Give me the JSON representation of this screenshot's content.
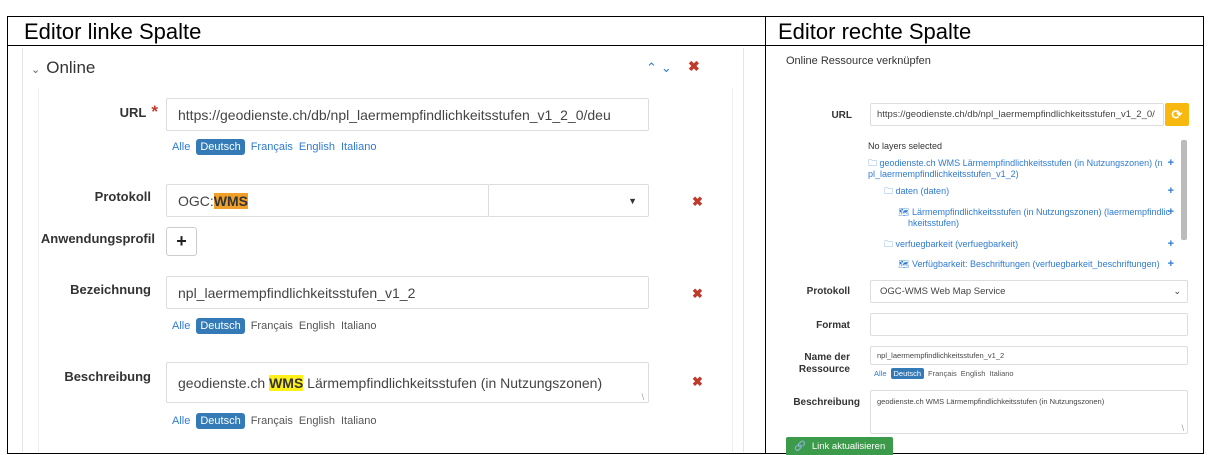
{
  "headers": {
    "left": "Editor linke Spalte",
    "right": "Editor rechte Spalte"
  },
  "left": {
    "section_title": "Online",
    "url": {
      "label": "URL",
      "required_mark": "*",
      "value": "https://geodienste.ch/db/npl_laermempfindlichkeitsstufen_v1_2_0/deu"
    },
    "languages": [
      "Alle",
      "Deutsch",
      "Français",
      "English",
      "Italiano"
    ],
    "protokoll": {
      "label": "Protokoll",
      "value_prefix": "OGC:",
      "value_highlight": "WMS"
    },
    "anwendungsprofil": {
      "label": "Anwendungsprofil",
      "add_label": "+"
    },
    "bezeichnung": {
      "label": "Bezeichnung",
      "value": "npl_laermempfindlichkeitsstufen_v1_2"
    },
    "beschreibung": {
      "label": "Beschreibung",
      "value_prefix": "geodienste.ch ",
      "value_highlight": "WMS",
      "value_suffix": " Lärmempfindlichkeitsstufen (in Nutzungszonen)"
    }
  },
  "right": {
    "title": "Online Ressource verknüpfen",
    "url": {
      "label": "URL",
      "value": "https://geodienste.ch/db/npl_laermempfindlichkeitsstufen_v1_2_0/"
    },
    "layers": {
      "none_selected": "No layers selected",
      "items": [
        {
          "text": "geodienste.ch WMS Lärmempfindlichkeitsstufen (in Nutzungszonen) (n",
          "text2": "pl_laermempfindlichkeitsstufen_v1_2)"
        },
        {
          "text": "daten (daten)"
        },
        {
          "text": "Lärmempfindlichkeitsstufen (in Nutzungszonen) (laermempfindlic",
          "text2": "hkeitsstufen)"
        },
        {
          "text": "verfuegbarkeit (verfuegbarkeit)"
        },
        {
          "text": "Verfügbarkeit: Beschriftungen (verfuegbarkeit_beschriftungen)"
        }
      ]
    },
    "protokoll": {
      "label": "Protokoll",
      "value": "OGC-WMS Web Map Service"
    },
    "format": {
      "label": "Format",
      "value": ""
    },
    "name": {
      "label_line1": "Name der",
      "label_line2": "Ressource",
      "value": "npl_laermempfindlichkeitsstufen_v1_2"
    },
    "languages": [
      "Alle",
      "Deutsch",
      "Français",
      "English",
      "Italiano"
    ],
    "beschreibung": {
      "label": "Beschreibung",
      "value": "geodienste.ch WMS Lärmempfindlichkeitsstufen (in Nutzungszonen)"
    },
    "update_button": "Link aktualisieren"
  }
}
